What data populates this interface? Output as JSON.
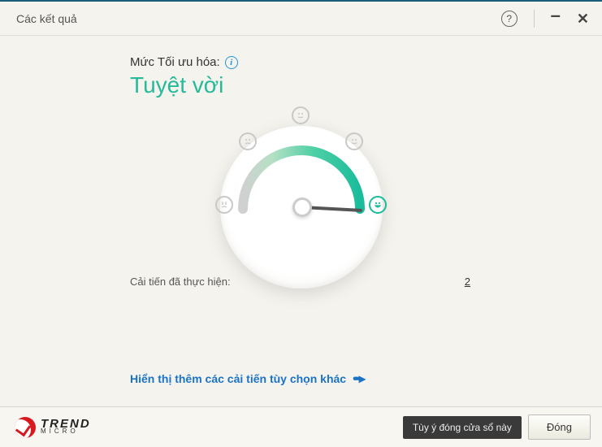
{
  "window": {
    "title": "Các kết quả"
  },
  "optimization": {
    "label": "Mức Tối ưu hóa:",
    "level": "Tuyệt vời"
  },
  "improvements": {
    "label": "Cải tiến đã thực hiện:",
    "count": "2"
  },
  "links": {
    "more": "Hiển thị thêm các cải tiến tùy chọn khác"
  },
  "footer": {
    "brand_top": "TREND",
    "brand_bottom": "MICRO",
    "tooltip": "Tùy ý đóng cửa sổ này",
    "close": "Đóng"
  }
}
